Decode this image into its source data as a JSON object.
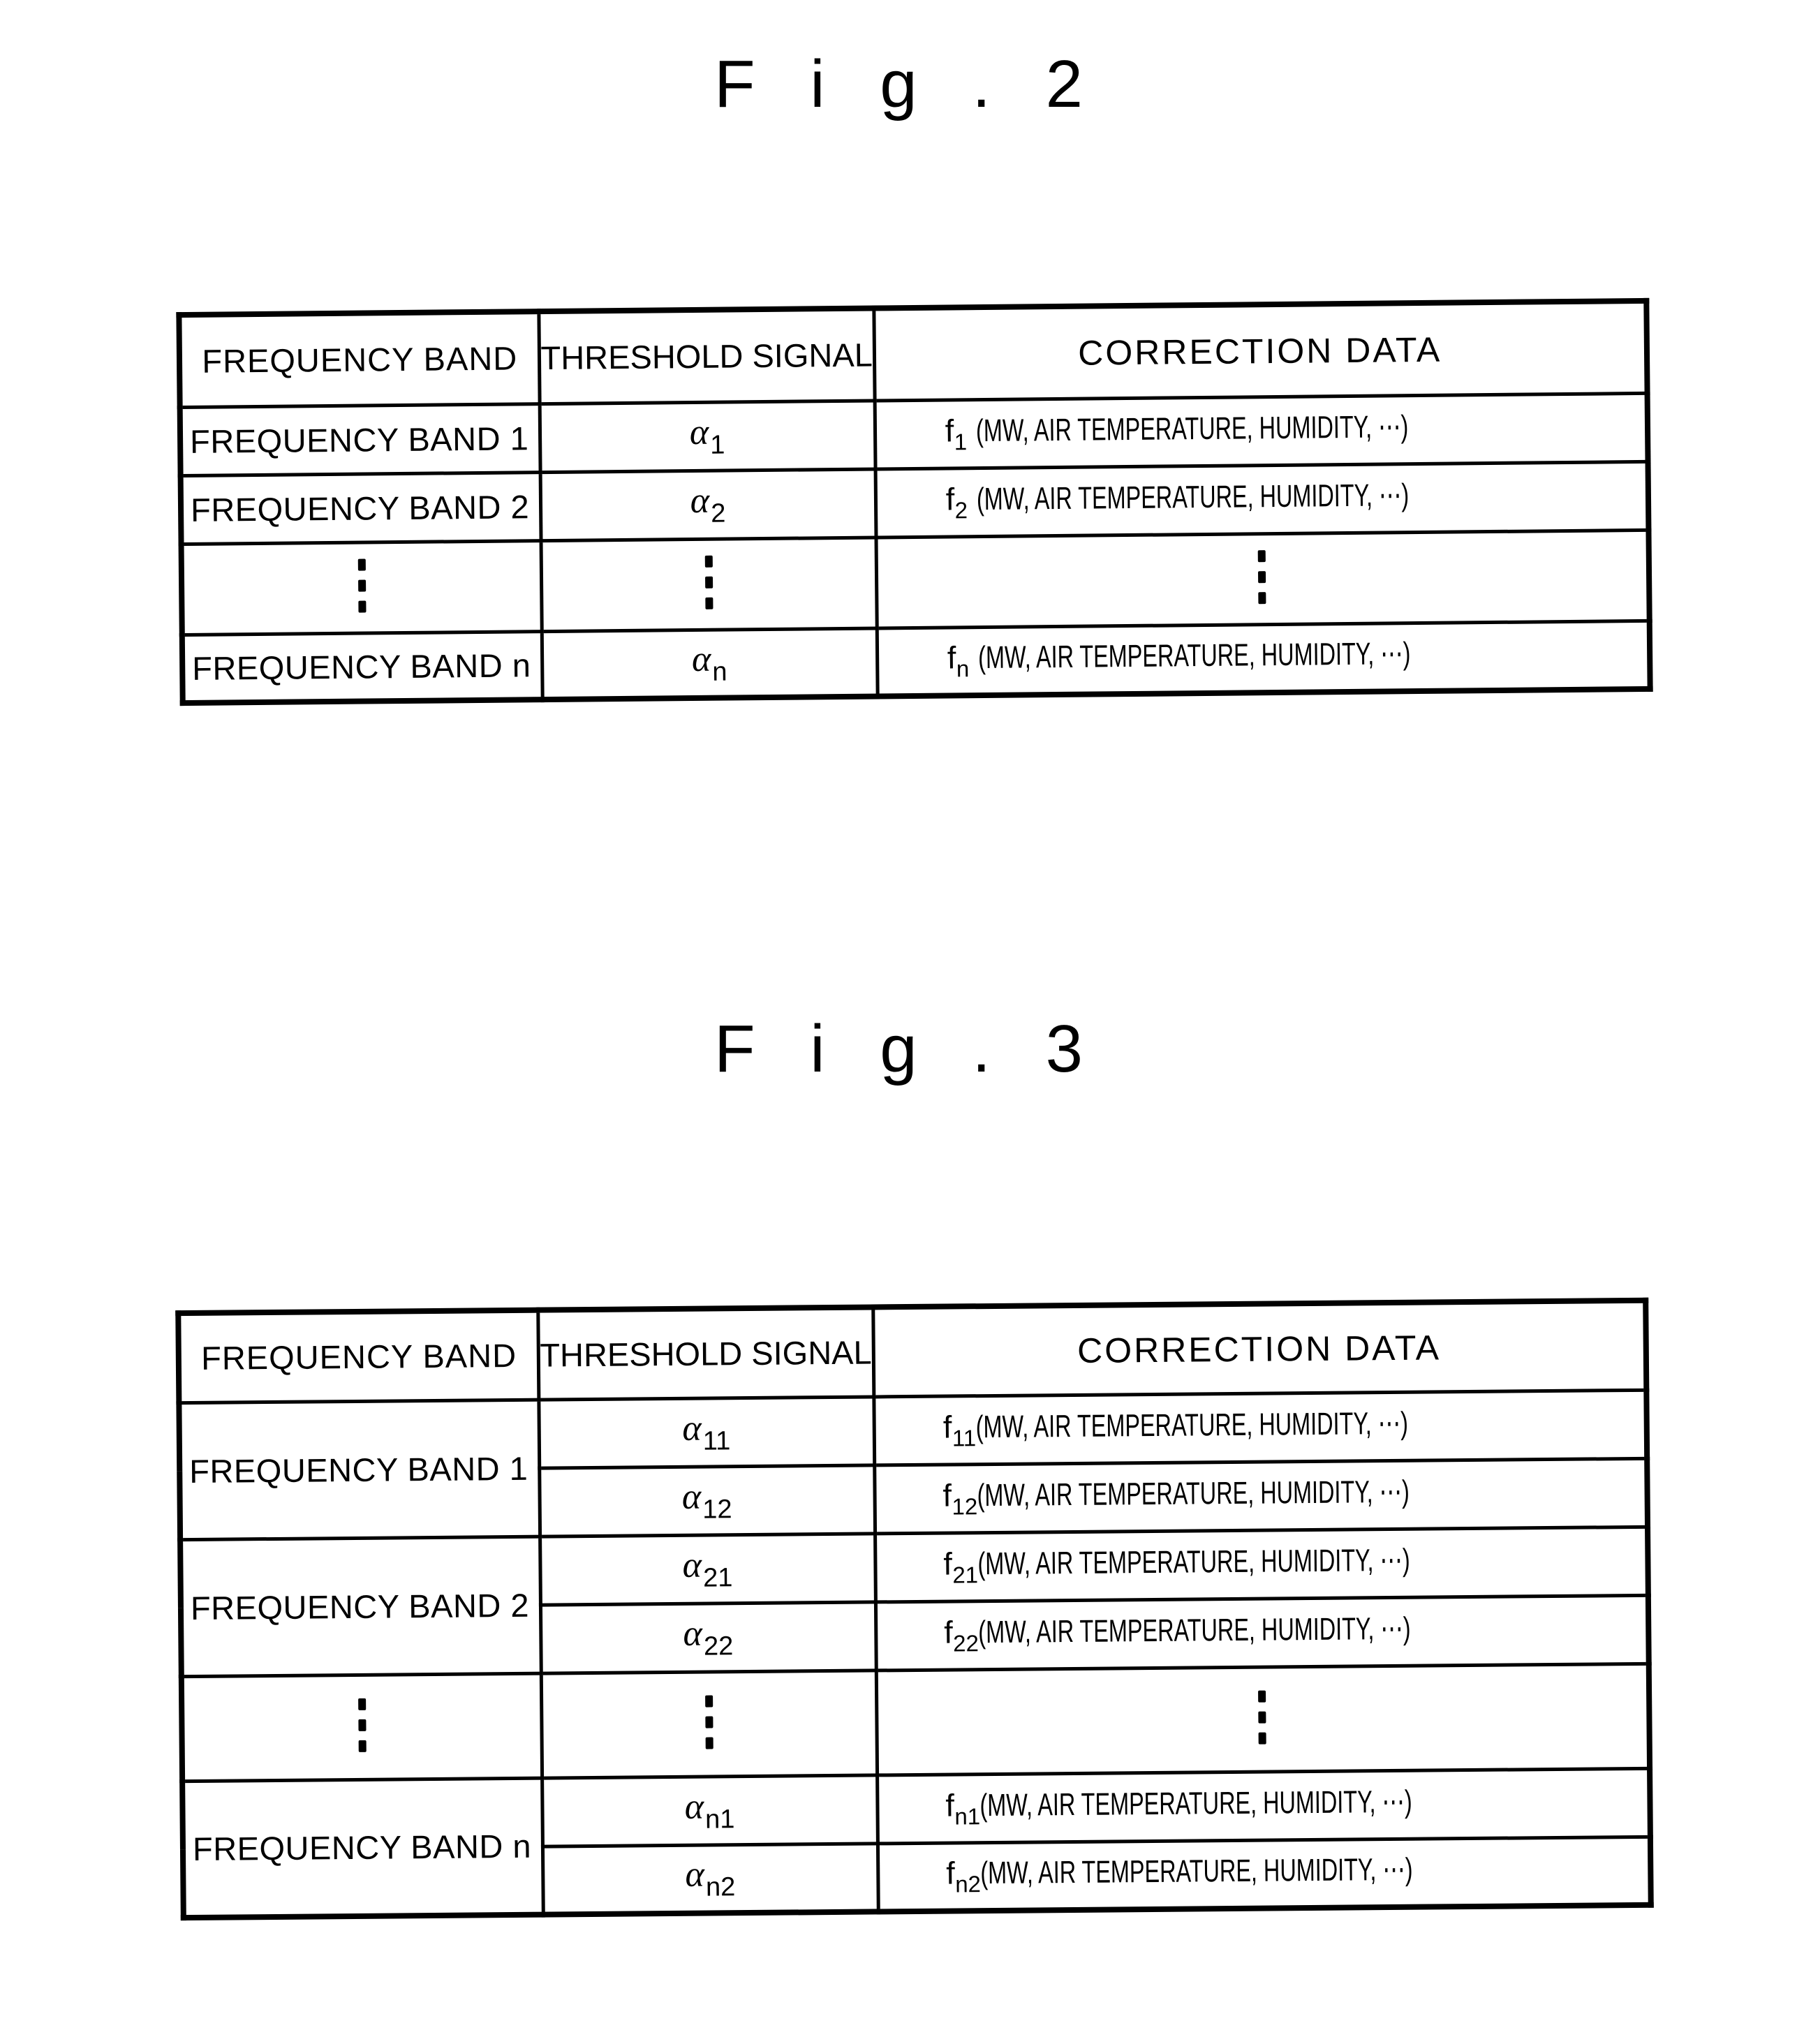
{
  "figures": [
    {
      "title": "F i g . 2",
      "columns": {
        "band": "FREQUENCY BAND",
        "threshold": "THRESHOLD SIGNAL",
        "correction": "CORRECTION DATA"
      },
      "rows": [
        {
          "band": "FREQUENCY BAND 1",
          "alpha_base": "α",
          "alpha_sub": "1",
          "f_base": "f",
          "f_sub": "1",
          "correction_args": "(MW, AIR TEMPERATURE,  HUMIDITY, ⋯)"
        },
        {
          "band": "FREQUENCY BAND 2",
          "alpha_base": "α",
          "alpha_sub": "2",
          "f_base": "f",
          "f_sub": "2",
          "correction_args": "(MW, AIR TEMPERATURE,  HUMIDITY, ⋯)"
        },
        {
          "band": "⋮",
          "alpha_base": "⋮",
          "alpha_sub": "",
          "f_base": "⋮",
          "f_sub": "",
          "correction_args": ""
        },
        {
          "band": "FREQUENCY BAND n",
          "alpha_base": "α",
          "alpha_sub": "n",
          "f_base": "f",
          "f_sub": "n",
          "correction_args": "(MW, AIR TEMPERATURE,  HUMIDITY, ⋯)"
        }
      ]
    },
    {
      "title": "F i g . 3",
      "columns": {
        "band": "FREQUENCY BAND",
        "threshold": "THRESHOLD SIGNAL",
        "correction": "CORRECTION DATA"
      },
      "groups": [
        {
          "band": "FREQUENCY BAND 1",
          "entries": [
            {
              "alpha_base": "α",
              "alpha_sub": "11",
              "f_base": "f",
              "f_sub": "11",
              "correction_args": "(MW, AIR TEMPERATURE,  HUMIDITY, ⋯)"
            },
            {
              "alpha_base": "α",
              "alpha_sub": "12",
              "f_base": "f",
              "f_sub": "12",
              "correction_args": "(MW, AIR TEMPERATURE,  HUMIDITY, ⋯)"
            }
          ]
        },
        {
          "band": "FREQUENCY BAND 2",
          "entries": [
            {
              "alpha_base": "α",
              "alpha_sub": "21",
              "f_base": "f",
              "f_sub": "21",
              "correction_args": "(MW, AIR TEMPERATURE,  HUMIDITY, ⋯)"
            },
            {
              "alpha_base": "α",
              "alpha_sub": "22",
              "f_base": "f",
              "f_sub": "22",
              "correction_args": "(MW, AIR TEMPERATURE,  HUMIDITY, ⋯)"
            }
          ]
        },
        {
          "band": "⋮",
          "ellipsis": true,
          "entries": [
            {
              "alpha_base": "⋮",
              "alpha_sub": "",
              "f_base": "⋮",
              "f_sub": "",
              "correction_args": ""
            }
          ]
        },
        {
          "band": "FREQUENCY BAND n",
          "entries": [
            {
              "alpha_base": "α",
              "alpha_sub": "n1",
              "f_base": "f",
              "f_sub": "n1",
              "correction_args": "(MW, AIR TEMPERATURE,  HUMIDITY, ⋯)"
            },
            {
              "alpha_base": "α",
              "alpha_sub": "n2",
              "f_base": "f",
              "f_sub": "n2",
              "correction_args": "(MW, AIR TEMPERATURE,  HUMIDITY, ⋯)"
            }
          ]
        }
      ]
    }
  ]
}
